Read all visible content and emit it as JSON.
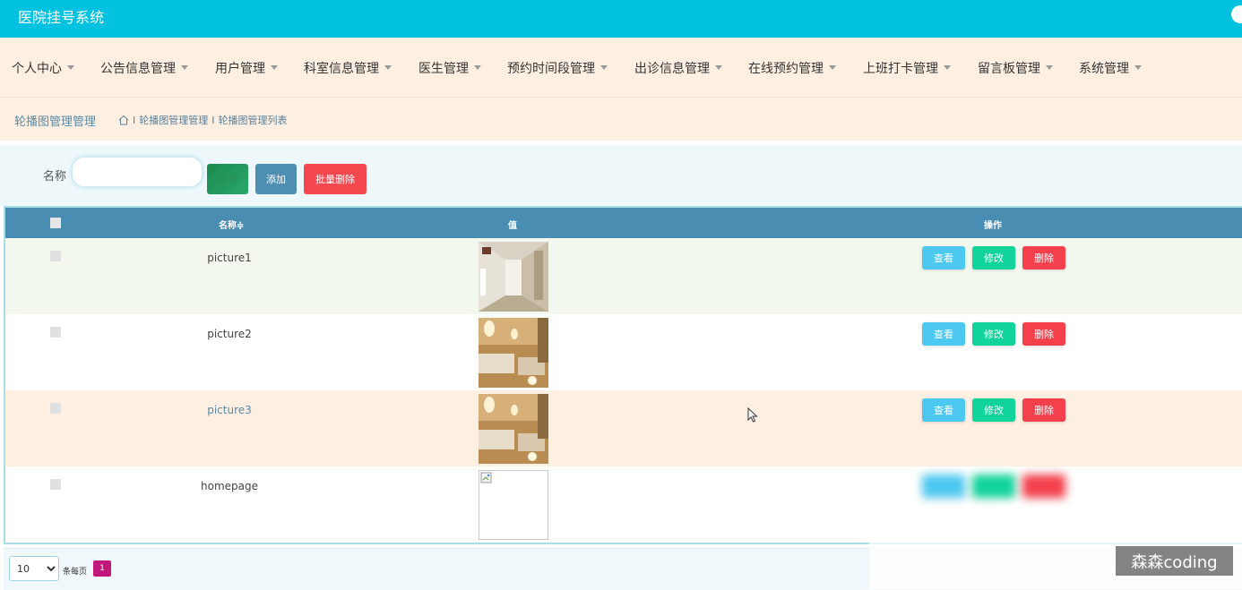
{
  "header": {
    "title": "医院挂号系统"
  },
  "nav": {
    "items": [
      {
        "label": "个人中心"
      },
      {
        "label": "公告信息管理"
      },
      {
        "label": "用户管理"
      },
      {
        "label": "科室信息管理"
      },
      {
        "label": "医生管理"
      },
      {
        "label": "预约时间段管理"
      },
      {
        "label": "出诊信息管理"
      },
      {
        "label": "在线预约管理"
      },
      {
        "label": "上班打卡管理"
      },
      {
        "label": "留言板管理"
      },
      {
        "label": "系统管理"
      }
    ]
  },
  "breadcrumb": {
    "title": "轮播图管理管理",
    "separator": "I",
    "level1": "轮播图管理管理",
    "level2": "轮播图管理列表"
  },
  "search": {
    "label": "名称",
    "value": "",
    "placeholder": "",
    "search_button": "查询",
    "add_button": "添加",
    "bulk_delete_button": "批量删除"
  },
  "table": {
    "headers": {
      "name": "名称≑",
      "value": "值",
      "actions": "操作"
    },
    "rows": [
      {
        "name": "picture1",
        "image": "corridor"
      },
      {
        "name": "picture2",
        "image": "ward"
      },
      {
        "name": "picture3",
        "image": "ward"
      },
      {
        "name": "homepage",
        "image": "broken"
      }
    ],
    "actions": {
      "view": "查看",
      "edit": "修改",
      "delete": "删除"
    }
  },
  "pagination": {
    "page_size": "10",
    "page_size_options": [
      "10"
    ],
    "per_page_label": "条每页",
    "current_page": "1"
  },
  "watermark": "森森coding",
  "colors": {
    "header": "#00c2e0",
    "nav_bg": "#fdf0e3",
    "table_head": "#4a8db3",
    "view": "#4dc8f0",
    "edit": "#10d49a",
    "delete": "#f4404c",
    "page_active": "#c2187c"
  }
}
